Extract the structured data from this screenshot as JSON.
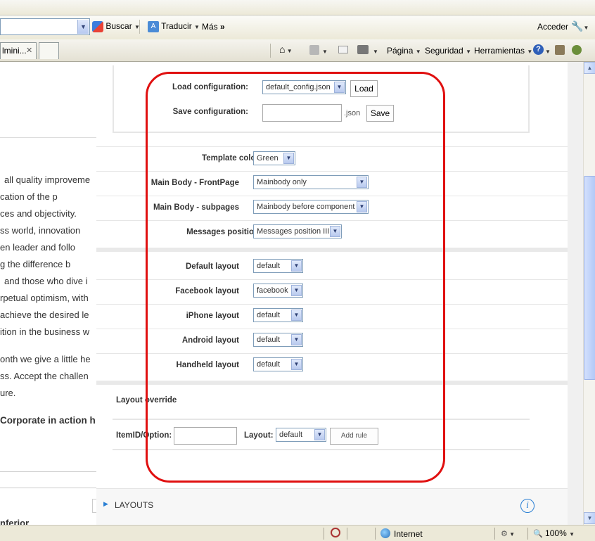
{
  "toolbar": {
    "search_label": "Buscar",
    "translate_label": "Traducir",
    "more_label": "Más",
    "more_glyph": "»",
    "signin_label": "Acceder"
  },
  "tabs": {
    "current_tab_label": "lmini...",
    "close_glyph": "✕"
  },
  "command_bar": {
    "page_label": "Página",
    "security_label": "Seguridad",
    "tools_label": "Herramientas"
  },
  "left_article": {
    "lines": [
      "all quality improveme",
      "cation   of   the   p",
      "ces   and   objectivity.",
      "ss  world,  innovation",
      "en  leader  and  follo",
      "g   the   difference   b",
      "and those who dive i",
      "rpetual optimism, with",
      "achieve the desired le",
      "ition in the business w",
      "onth we give a little he",
      "ss. Accept the challen",
      "ure."
    ],
    "heading": "Corporate in action h",
    "bottom_heading": "nferior"
  },
  "config": {
    "load_label": "Load configuration:",
    "load_value": "default_config.json",
    "load_button": "Load",
    "save_label": "Save configuration:",
    "save_value": "",
    "save_suffix": ".json",
    "save_button": "Save"
  },
  "settings": {
    "template_color_label": "Template color",
    "template_color_value": "Green",
    "main_body_front_label": "Main Body - FrontPage",
    "main_body_front_value": "Mainbody only",
    "main_body_sub_label": "Main Body - subpages",
    "main_body_sub_value": "Mainbody before component",
    "messages_label": "Messages position",
    "messages_value": "Messages position III"
  },
  "layouts": {
    "default_label": "Default layout",
    "default_value": "default",
    "facebook_label": "Facebook layout",
    "facebook_value": "facebook",
    "iphone_label": "iPhone layout",
    "iphone_value": "default",
    "android_label": "Android layout",
    "android_value": "default",
    "handheld_label": "Handheld layout",
    "handheld_value": "default"
  },
  "override": {
    "title": "Layout override",
    "itemid_label": "ItemID/Option:",
    "itemid_value": "",
    "layout_label": "Layout:",
    "layout_value": "default",
    "add_rule_button": "Add rule"
  },
  "section": {
    "layouts_title": "LAYOUTS",
    "info_glyph": "i"
  },
  "statusbar": {
    "zone": "Internet",
    "zoom": "100%"
  },
  "colors": {
    "highlight_frame": "#e01010",
    "section_arrow": "#2a7fd4"
  }
}
